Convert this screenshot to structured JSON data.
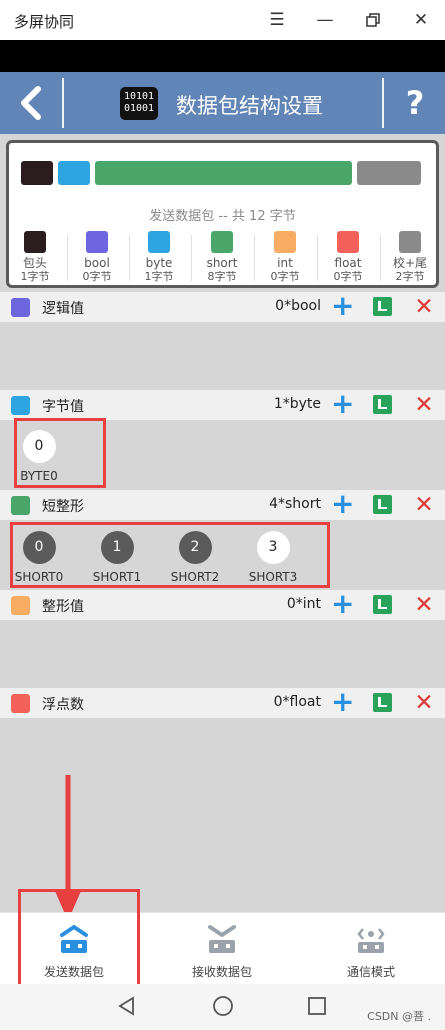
{
  "window": {
    "title": "多屏协同",
    "menu_icon": "menu-icon",
    "minimize_icon": "minimize-icon",
    "restore_icon": "restore-icon",
    "close_icon": "close-icon"
  },
  "header": {
    "title": "数据包结构设置",
    "icon_text_line1": "10101",
    "icon_text_line2": "01001",
    "help_label": "?"
  },
  "summary": {
    "text": "发送数据包 -- 共 12 字节",
    "legend": [
      {
        "name": "包头",
        "count": "1字节",
        "color": "#2b1c20"
      },
      {
        "name": "bool",
        "count": "0字节",
        "color": "#6e66e0"
      },
      {
        "name": "byte",
        "count": "1字节",
        "color": "#2ea4e0"
      },
      {
        "name": "short",
        "count": "8字节",
        "color": "#4aa669"
      },
      {
        "name": "int",
        "count": "0字节",
        "color": "#f7ac64"
      },
      {
        "name": "float",
        "count": "0字节",
        "color": "#f2625a"
      },
      {
        "name": "校+尾",
        "count": "2字节",
        "color": "#8a8a8a"
      }
    ]
  },
  "sections": [
    {
      "name": "逻辑值",
      "count": "0*bool",
      "color": "#6e66e0",
      "items": []
    },
    {
      "name": "字节值",
      "count": "1*byte",
      "color": "#2ea4e0",
      "items": [
        {
          "value": "0",
          "label": "BYTE0"
        }
      ]
    },
    {
      "name": "短整形",
      "count": "4*short",
      "color": "#4aa669",
      "items": [
        {
          "value": "0",
          "label": "SHORT0"
        },
        {
          "value": "1",
          "label": "SHORT1"
        },
        {
          "value": "2",
          "label": "SHORT2"
        },
        {
          "value": "3",
          "label": "SHORT3"
        }
      ]
    },
    {
      "name": "整形值",
      "count": "0*int",
      "color": "#f7ac64",
      "items": []
    },
    {
      "name": "浮点数",
      "count": "0*float",
      "color": "#f2625a",
      "items": []
    }
  ],
  "bottom_nav": {
    "tabs": [
      {
        "label": "发送数据包",
        "icon": "send-packet-icon",
        "active": true
      },
      {
        "label": "接收数据包",
        "icon": "receive-packet-icon",
        "active": false
      },
      {
        "label": "通信模式",
        "icon": "comm-mode-icon",
        "active": false
      }
    ]
  },
  "watermark": "CSDN @菩 ."
}
